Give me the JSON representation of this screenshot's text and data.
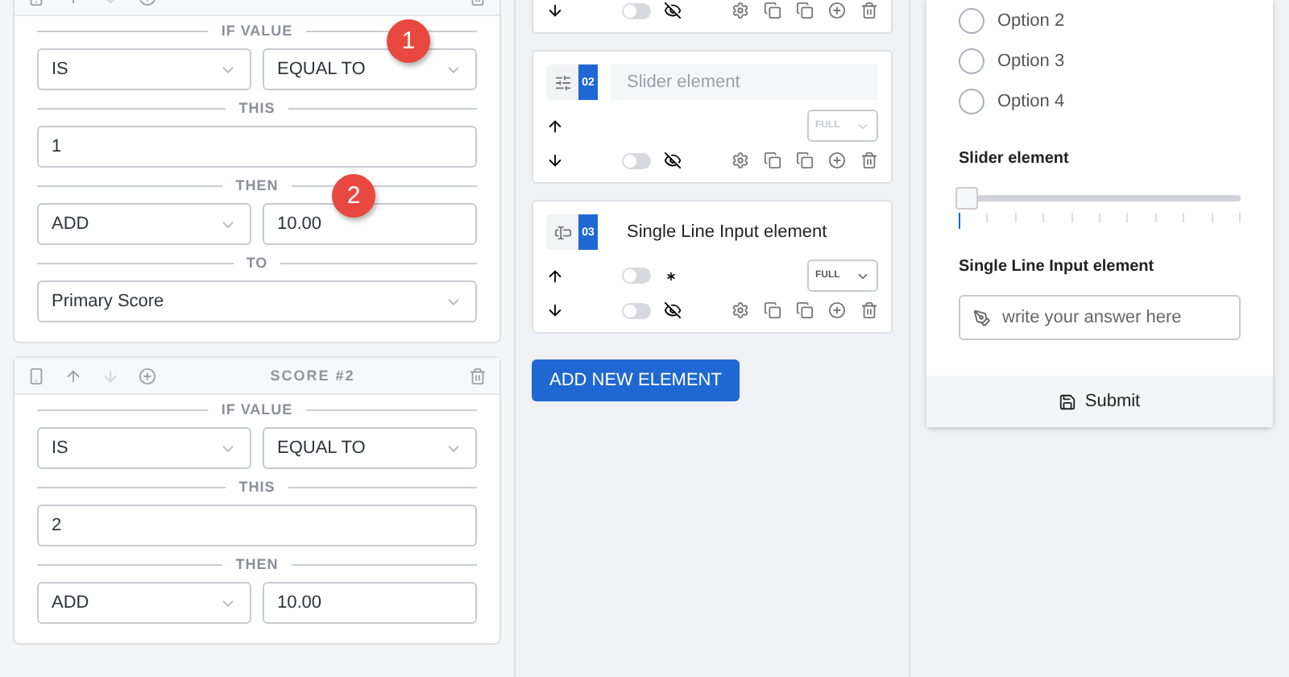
{
  "rules": [
    {
      "if_label": "IF VALUE",
      "operator": "IS",
      "comparison": "EQUAL TO",
      "this_label": "THIS",
      "value": "1",
      "then_label": "THEN",
      "action": "ADD",
      "amount": "10.00",
      "to_label": "TO",
      "target": "Primary Score"
    },
    {
      "title": "SCORE #2",
      "if_label": "IF VALUE",
      "operator": "IS",
      "comparison": "EQUAL TO",
      "this_label": "THIS",
      "value": "2",
      "then_label": "THEN",
      "action": "ADD",
      "amount": "10.00"
    }
  ],
  "elements": [
    {
      "kind": "partial",
      "hidden": false
    },
    {
      "kind": "slider",
      "number": "02",
      "title": "Slider element",
      "disabled": true,
      "width": "FULL",
      "hidden": false
    },
    {
      "kind": "input",
      "number": "03",
      "title": "Single Line Input element",
      "disabled": false,
      "width": "FULL",
      "required": false,
      "hidden": false
    }
  ],
  "add_button": "ADD NEW ELEMENT",
  "preview": {
    "options": [
      {
        "label": "Option 2",
        "selected": false
      },
      {
        "label": "Option 3",
        "selected": false
      },
      {
        "label": "Option 4",
        "selected": false
      }
    ],
    "slider": {
      "label": "Slider element",
      "level": 0
    },
    "input": {
      "label": "Single Line Input element",
      "placeholder": "write your answer here"
    },
    "submit": "Submit"
  },
  "callouts": [
    "1",
    "2"
  ]
}
